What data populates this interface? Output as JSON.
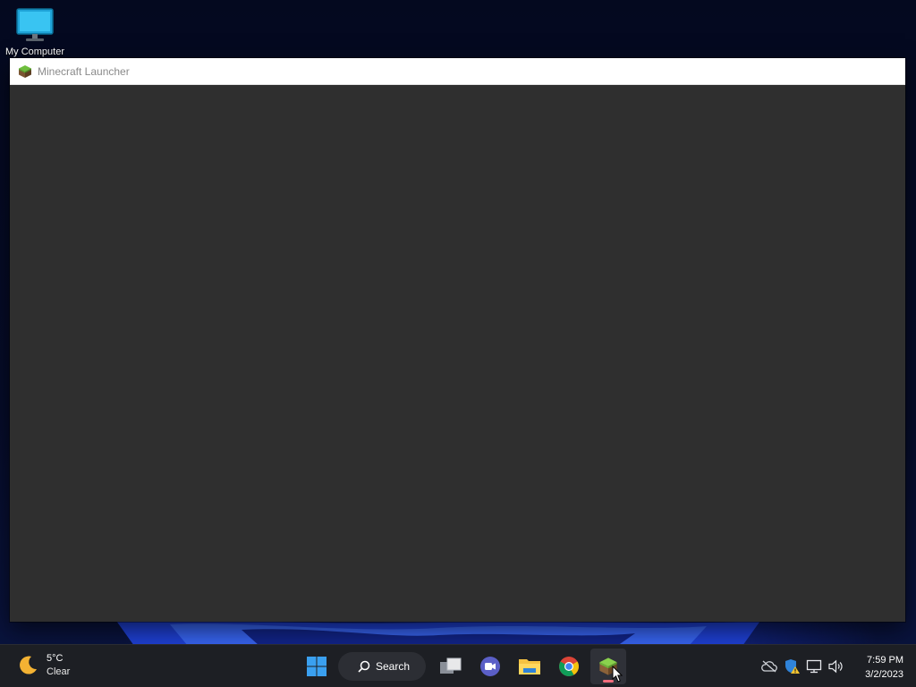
{
  "desktop": {
    "icons": [
      {
        "label": "My Computer",
        "icon": "monitor-icon"
      }
    ]
  },
  "window": {
    "title": "Minecraft Launcher",
    "icon": "grass-block-icon",
    "body_color": "#2f2f2f"
  },
  "taskbar": {
    "weather": {
      "temperature": "5°C",
      "condition": "Clear",
      "icon": "moon-icon"
    },
    "search": {
      "label": "Search"
    },
    "apps": [
      {
        "name": "Start",
        "icon": "windows-logo-icon"
      },
      {
        "name": "Task View",
        "icon": "task-view-icon"
      },
      {
        "name": "Teams",
        "icon": "teams-chat-icon"
      },
      {
        "name": "File Explorer",
        "icon": "folder-icon"
      },
      {
        "name": "Chrome",
        "icon": "chrome-icon"
      },
      {
        "name": "Minecraft Launcher",
        "icon": "grass-block-icon",
        "active": true
      }
    ],
    "tray": {
      "icons": [
        "cloud-offline-icon",
        "security-warning-icon",
        "network-icon",
        "volume-icon"
      ],
      "time": "7:59 PM",
      "date": "3/2/2023"
    }
  },
  "colors": {
    "accent_windows": "#3aa0f0",
    "active_indicator": "#f26d7d",
    "taskbar_bg": "#1d1f24"
  }
}
